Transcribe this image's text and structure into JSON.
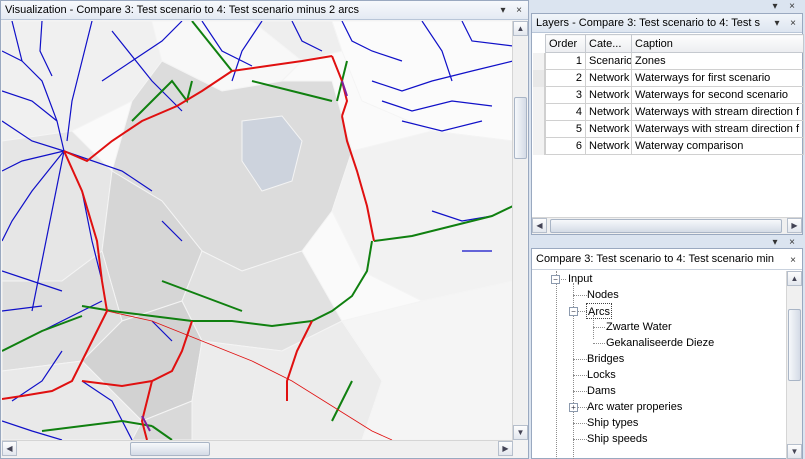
{
  "viz": {
    "title": "Visualization - Compare 3: Test scenario to 4: Test scenario minus 2 arcs"
  },
  "layers": {
    "title": "Layers - Compare 3: Test scenario to 4: Test s",
    "columns": [
      "Order",
      "Cate...",
      "Caption"
    ],
    "rows": [
      {
        "order": "1",
        "category": "Scenario",
        "caption": "Zones"
      },
      {
        "order": "2",
        "category": "Network",
        "caption": "Waterways for first scenario"
      },
      {
        "order": "3",
        "category": "Network",
        "caption": "Waterways for second scenario"
      },
      {
        "order": "4",
        "category": "Network",
        "caption": "Waterways with stream direction f"
      },
      {
        "order": "5",
        "category": "Network",
        "caption": "Waterways with stream direction f"
      },
      {
        "order": "6",
        "category": "Network",
        "caption": "Waterway comparison"
      }
    ]
  },
  "tree": {
    "title": "Compare 3: Test scenario to 4: Test scenario min",
    "items": [
      {
        "label": "Input"
      },
      {
        "label": "Nodes"
      },
      {
        "label": "Arcs"
      },
      {
        "label": "Zwarte Water"
      },
      {
        "label": "Gekanaliseerde Dieze"
      },
      {
        "label": "Bridges"
      },
      {
        "label": "Locks"
      },
      {
        "label": "Dams"
      },
      {
        "label": "Arc water properies"
      },
      {
        "label": "Ship types"
      },
      {
        "label": "Ship speeds"
      }
    ]
  },
  "colors": {
    "waterway": "#1010c8",
    "scenario_red": "#e01010",
    "scenario_green": "#108010",
    "zone_grey": "#e6e6e6"
  },
  "icons": {
    "close": "×",
    "pin": "▾",
    "scroll_up": "▲",
    "scroll_down": "▼",
    "scroll_left": "◀",
    "scroll_right": "▶",
    "expand": "+",
    "collapse": "−"
  }
}
